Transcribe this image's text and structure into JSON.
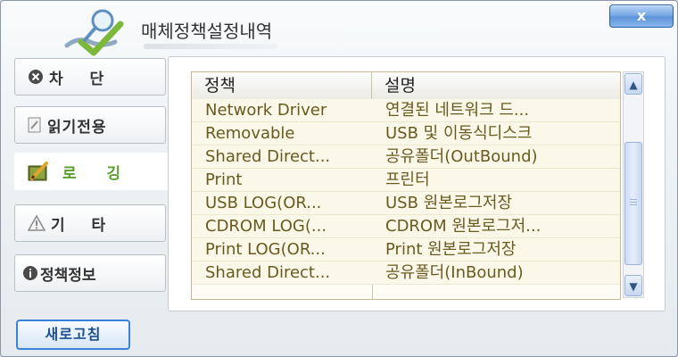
{
  "window": {
    "title": "매체정책설정내역",
    "close_label": "x"
  },
  "menu": {
    "items": [
      {
        "label": "차  단",
        "icon": "x-circle-icon"
      },
      {
        "label": "읽기전용",
        "icon": "document-icon"
      },
      {
        "label": "로  깅",
        "icon": "pencil-notebook-icon"
      },
      {
        "label": "기  타",
        "icon": "warning-icon"
      },
      {
        "label": "정책정보",
        "icon": "info-icon"
      }
    ],
    "active_index": 2
  },
  "table": {
    "headers": [
      "정책",
      "설명"
    ],
    "rows": [
      [
        "Network Driver",
        "연결된 네트워크 드..."
      ],
      [
        "Removable",
        "USB 및 이동식디스크"
      ],
      [
        "Shared Direct...",
        "공유폴더(OutBound)"
      ],
      [
        "Print",
        "프린터"
      ],
      [
        "USB LOG(OR...",
        "USB 원본로그저장"
      ],
      [
        "CDROM LOG(...",
        "CDROM 원본로그저..."
      ],
      [
        "Print LOG(OR...",
        "Print 원본로그저장"
      ],
      [
        "Shared Direct...",
        "공유폴더(InBound)"
      ]
    ]
  },
  "refresh_label": "새로고침",
  "colors": {
    "accent": "#3b83d6",
    "active_menu_text": "#5a9e2b",
    "row_text": "#6a5a1f"
  }
}
